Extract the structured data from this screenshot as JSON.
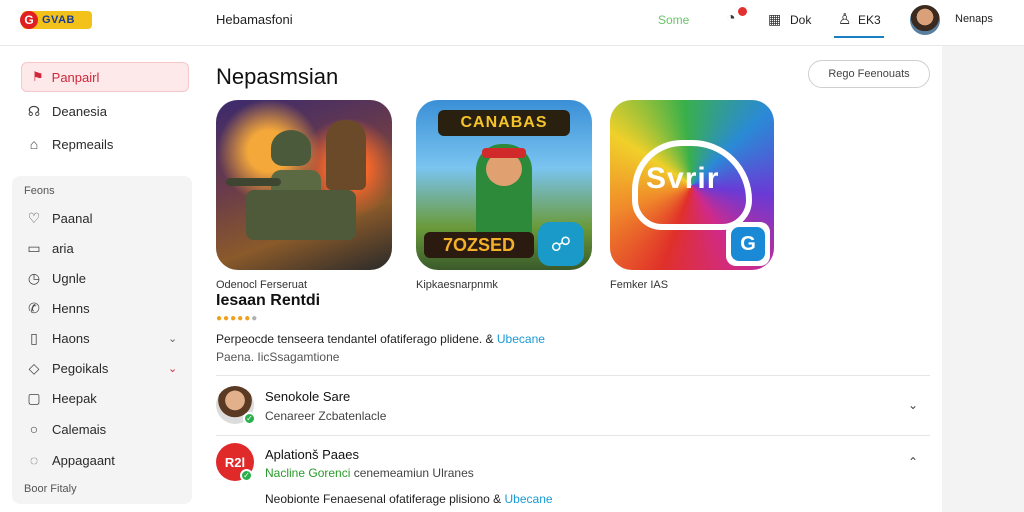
{
  "topbar": {
    "logo_text": "GVAB",
    "logo_mark": "G",
    "app_title": "Hebamasfoni",
    "status_link": "Some",
    "label_1": "Dok",
    "label_2": "EK3",
    "user_name": "Nenaps"
  },
  "sidebar": {
    "active_item": "Panpairl",
    "items": [
      {
        "label": "Deanesia",
        "icon": "leaf-icon"
      },
      {
        "label": "Repmeails",
        "icon": "home-icon"
      }
    ],
    "panel_header": "Feons",
    "panel_items": [
      {
        "label": "Paanal",
        "icon": "heart-icon"
      },
      {
        "label": "aria",
        "icon": "calendar-icon"
      },
      {
        "label": "Ugnle",
        "icon": "clock-icon"
      },
      {
        "label": "Henns",
        "icon": "phone-icon"
      },
      {
        "label": "Haons",
        "icon": "book-icon"
      },
      {
        "label": "Pegoikals",
        "icon": "tag-icon"
      },
      {
        "label": "Heepak",
        "icon": "square-icon"
      },
      {
        "label": "Calemais",
        "icon": "circle-icon"
      },
      {
        "label": "Appagaant",
        "icon": "bell-icon"
      }
    ],
    "panel_footer": "Boor Fitaly"
  },
  "main": {
    "title": "Nepasmsian",
    "header_button": "Rego Feenouats",
    "cards": [
      {
        "caption": "Odenocl Ferseruat",
        "banner": "",
        "tag": ""
      },
      {
        "caption": "Kipkaesnarpnmk",
        "banner": "CANABAS",
        "tag": "7OZSED"
      },
      {
        "caption": "Femker IAS",
        "word": "Svrir"
      }
    ],
    "featured": {
      "name": "Iesaan Rentdi",
      "rating_filled": 5,
      "rating_total": 6,
      "desc": "Perpeocde tenseera tendantel ofatiferago plidene. &",
      "desc_link": "Ubecane",
      "sub": "Paena. IicSsagamtione"
    },
    "rows": [
      {
        "title": "Senokole Sare",
        "sub_green": "",
        "sub": "Cenareer Zcbatenlacle",
        "chevron": "⌄"
      },
      {
        "title": "Aplationš Paaes",
        "sub_green": "Nacline Gorenci",
        "sub": " cenemeamiun Ulranes",
        "chevron": "⌃",
        "avatar_text": "R2l"
      }
    ],
    "row_desc": "Neobionte Fenaesenal ofatiferage plisiono &",
    "row_desc_link": "Ubecane"
  }
}
